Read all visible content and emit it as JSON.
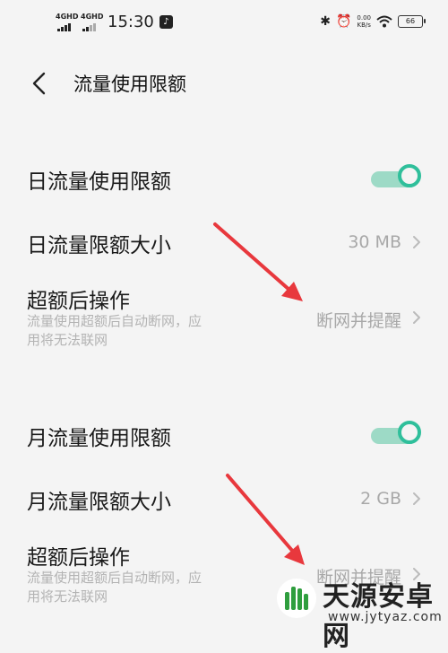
{
  "status_bar": {
    "net1": "4GHD",
    "net2": "4GHD",
    "time": "15:30",
    "speed_value": "0.00",
    "speed_unit": "KB/s",
    "battery": "66"
  },
  "header": {
    "title": "流量使用限额"
  },
  "daily": {
    "toggle_label": "日流量使用限额",
    "toggle_on": true,
    "size_label": "日流量限额大小",
    "size_value": "30 MB",
    "action_label": "超额后操作",
    "action_desc": "流量使用超额后自动断网，应用将无法联网",
    "action_value": "断网并提醒"
  },
  "monthly": {
    "toggle_label": "月流量使用限额",
    "toggle_on": true,
    "size_label": "月流量限额大小",
    "size_value": "2 GB",
    "action_label": "超额后操作",
    "action_desc": "流量使用超额后自动断网，应用将无法联网",
    "action_value": "断网并提醒"
  },
  "watermark": {
    "name": "天源安卓网",
    "url": "www.jytyaz.com"
  },
  "colors": {
    "accent": "#2fbf9b",
    "arrow": "#e8383d",
    "value": "#a8a8a8"
  }
}
